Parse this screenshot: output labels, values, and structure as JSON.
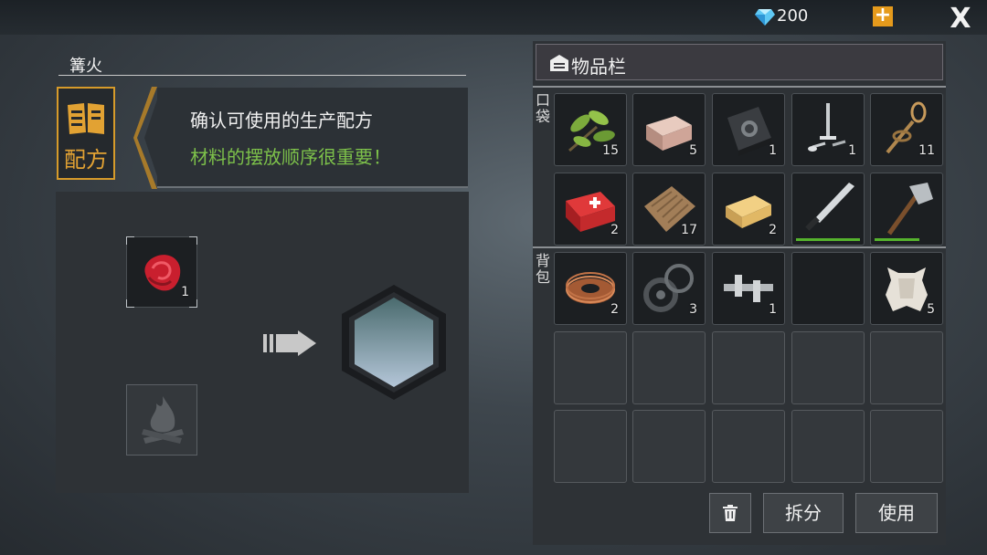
{
  "currency": {
    "gems": "200"
  },
  "workbench": {
    "title": "篝火"
  },
  "recipe_tab": {
    "label": "配方"
  },
  "info": {
    "line1": "确认可使用的生产配方",
    "line2": "材料的摆放顺序很重要！"
  },
  "craft": {
    "materials": [
      {
        "icon": "raw-meat-icon",
        "qty": "1"
      }
    ],
    "station_icon": "campfire-icon",
    "result": "empty"
  },
  "inventory": {
    "title": "物品栏",
    "pocket_label": "口袋",
    "backpack_label": "背包",
    "pocket": [
      {
        "icon": "herb-leaves-icon",
        "qty": "15"
      },
      {
        "icon": "stone-brick-icon",
        "qty": "5"
      },
      {
        "icon": "book-icon",
        "qty": "1"
      },
      {
        "icon": "nails-icon",
        "qty": "1"
      },
      {
        "icon": "rope-icon",
        "qty": "11"
      },
      {
        "icon": "first-aid-kit-icon",
        "qty": "2"
      },
      {
        "icon": "cloth-icon",
        "qty": "17"
      },
      {
        "icon": "wood-plank-icon",
        "qty": "2"
      },
      {
        "icon": "machete-icon",
        "qty": "",
        "durability": 1.0
      },
      {
        "icon": "stone-axe-icon",
        "qty": "",
        "durability": 0.7
      }
    ],
    "backpack": [
      {
        "icon": "copper-wire-icon",
        "qty": "2"
      },
      {
        "icon": "gaskets-icon",
        "qty": "3"
      },
      {
        "icon": "crankshaft-icon",
        "qty": "1"
      },
      {
        "icon": "",
        "qty": ""
      },
      {
        "icon": "animal-hide-icon",
        "qty": "5"
      }
    ],
    "empty_rows": 2
  },
  "buttons": {
    "split": "拆分",
    "use": "使用"
  }
}
